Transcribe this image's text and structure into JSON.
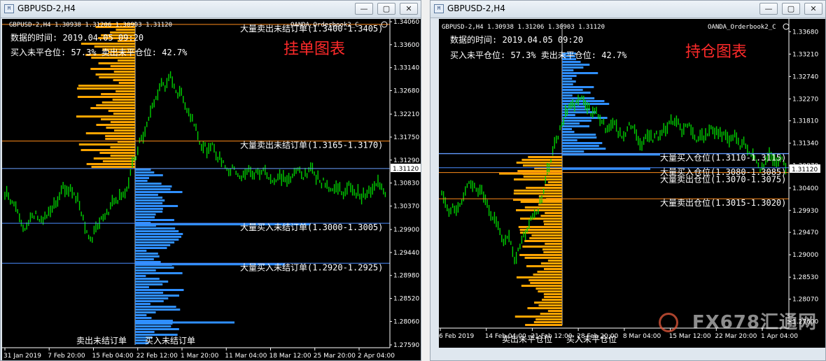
{
  "left": {
    "window_title": "GBPUSD-2,H4",
    "header_line": "GBPUSD-2,H4  1.30938 1.31206 1.30903 1.31120",
    "indicator_name": "OANDA_Orderbook2_C",
    "time_line": "数据的时间: 2019.04.05 09:20",
    "ratio_line": "买入未平仓位: 57.3%  卖出未平仓位: 42.7%",
    "chart_title": "挂单图表",
    "annotations": [
      {
        "text": "大量卖出未结订单(1.3400-1.3405)",
        "price": 1.34005
      },
      {
        "text": "大量卖出未结订单(1.3165-1.3170)",
        "price": 1.3167
      },
      {
        "text": "大量买入未结订单(1.3000-1.3005)",
        "price": 1.30025
      },
      {
        "text": "大量买入未结订单(1.2920-1.2925)",
        "price": 1.29225
      }
    ],
    "current_price": "1.31120",
    "sell_label": "卖出未结订单",
    "buy_label": "买入未结订单",
    "price_ticks": [
      "1.34060",
      "1.33600",
      "1.33140",
      "1.32680",
      "1.32210",
      "1.31750",
      "1.31290",
      "1.30830",
      "1.30370",
      "1.29900",
      "1.29440",
      "1.28980",
      "1.28520",
      "1.28060",
      "1.27590"
    ],
    "time_ticks": [
      "31 Jan 2019",
      "7 Feb 20:00",
      "15 Feb 04:00",
      "22 Feb 12:00",
      "1 Mar 20:00",
      "11 Mar 04:00",
      "18 Mar 12:00",
      "25 Mar 20:00",
      "2 Apr 04:00"
    ]
  },
  "right": {
    "window_title": "GBPUSD-2,H4",
    "header_line": "GBPUSD-2,H4  1.30938 1.31206 1.30903 1.31120",
    "indicator_name": "OANDA_Orderbook2_C",
    "time_line": "数据的时间: 2019.04.05 09:20",
    "ratio_line": "买入未平仓位: 57.3%  卖出未平仓位: 42.7%",
    "chart_title": "持仓图表",
    "annotations": [
      {
        "text": "大量买入仓位(1.3110-1.3115)",
        "price": 1.31125
      },
      {
        "text": "大量买入仓位(1.3080-1.3085)",
        "price": 1.30825
      },
      {
        "text": "大量卖出仓位(1.3070-1.3075)",
        "price": 1.30725
      },
      {
        "text": "大量卖出仓位(1.3015-1.3020)",
        "price": 1.30175
      }
    ],
    "current_price": "1.31120",
    "sell_label": "卖出未平仓位",
    "buy_label": "买入未平仓位",
    "price_ticks": [
      "1.33680",
      "1.33210",
      "1.32740",
      "1.32270",
      "1.31810",
      "1.31340",
      "1.30870",
      "1.30400",
      "1.29930",
      "1.29470",
      "1.29000",
      "1.28530",
      "1.28070",
      "1.27600"
    ],
    "time_ticks": [
      "6 Feb 2019",
      "14 Feb 04:00",
      "21 Feb 12:00",
      "28 Feb 20:00",
      "8 Mar 04:00",
      "15 Mar 12:00",
      "22 Mar 20:00",
      "1 Apr 04:00"
    ]
  },
  "watermark": "FX678汇通网",
  "colors": {
    "candle": "#00d000",
    "sell": "#ffa500",
    "buy": "#2f8fff",
    "level_sell": "#ff8c1a",
    "level_buy": "#4a8cff",
    "title_red": "#ff2a2a"
  },
  "icons": {
    "app": "mt4-chart-icon",
    "minimize": "minimize-icon",
    "maximize": "maximize-icon",
    "close": "close-icon"
  }
}
